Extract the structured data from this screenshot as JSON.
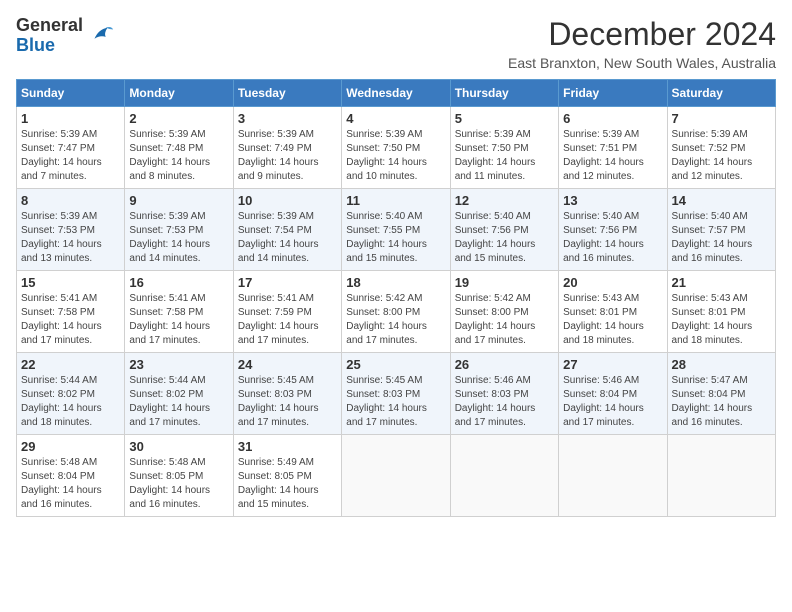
{
  "logo": {
    "line1": "General",
    "line2": "Blue"
  },
  "title": "December 2024",
  "location": "East Branxton, New South Wales, Australia",
  "days_header": [
    "Sunday",
    "Monday",
    "Tuesday",
    "Wednesday",
    "Thursday",
    "Friday",
    "Saturday"
  ],
  "weeks": [
    [
      {
        "day": "1",
        "sunrise": "5:39 AM",
        "sunset": "7:47 PM",
        "daylight": "14 hours and 7 minutes."
      },
      {
        "day": "2",
        "sunrise": "5:39 AM",
        "sunset": "7:48 PM",
        "daylight": "14 hours and 8 minutes."
      },
      {
        "day": "3",
        "sunrise": "5:39 AM",
        "sunset": "7:49 PM",
        "daylight": "14 hours and 9 minutes."
      },
      {
        "day": "4",
        "sunrise": "5:39 AM",
        "sunset": "7:50 PM",
        "daylight": "14 hours and 10 minutes."
      },
      {
        "day": "5",
        "sunrise": "5:39 AM",
        "sunset": "7:50 PM",
        "daylight": "14 hours and 11 minutes."
      },
      {
        "day": "6",
        "sunrise": "5:39 AM",
        "sunset": "7:51 PM",
        "daylight": "14 hours and 12 minutes."
      },
      {
        "day": "7",
        "sunrise": "5:39 AM",
        "sunset": "7:52 PM",
        "daylight": "14 hours and 12 minutes."
      }
    ],
    [
      {
        "day": "8",
        "sunrise": "5:39 AM",
        "sunset": "7:53 PM",
        "daylight": "14 hours and 13 minutes."
      },
      {
        "day": "9",
        "sunrise": "5:39 AM",
        "sunset": "7:53 PM",
        "daylight": "14 hours and 14 minutes."
      },
      {
        "day": "10",
        "sunrise": "5:39 AM",
        "sunset": "7:54 PM",
        "daylight": "14 hours and 14 minutes."
      },
      {
        "day": "11",
        "sunrise": "5:40 AM",
        "sunset": "7:55 PM",
        "daylight": "14 hours and 15 minutes."
      },
      {
        "day": "12",
        "sunrise": "5:40 AM",
        "sunset": "7:56 PM",
        "daylight": "14 hours and 15 minutes."
      },
      {
        "day": "13",
        "sunrise": "5:40 AM",
        "sunset": "7:56 PM",
        "daylight": "14 hours and 16 minutes."
      },
      {
        "day": "14",
        "sunrise": "5:40 AM",
        "sunset": "7:57 PM",
        "daylight": "14 hours and 16 minutes."
      }
    ],
    [
      {
        "day": "15",
        "sunrise": "5:41 AM",
        "sunset": "7:58 PM",
        "daylight": "14 hours and 17 minutes."
      },
      {
        "day": "16",
        "sunrise": "5:41 AM",
        "sunset": "7:58 PM",
        "daylight": "14 hours and 17 minutes."
      },
      {
        "day": "17",
        "sunrise": "5:41 AM",
        "sunset": "7:59 PM",
        "daylight": "14 hours and 17 minutes."
      },
      {
        "day": "18",
        "sunrise": "5:42 AM",
        "sunset": "8:00 PM",
        "daylight": "14 hours and 17 minutes."
      },
      {
        "day": "19",
        "sunrise": "5:42 AM",
        "sunset": "8:00 PM",
        "daylight": "14 hours and 17 minutes."
      },
      {
        "day": "20",
        "sunrise": "5:43 AM",
        "sunset": "8:01 PM",
        "daylight": "14 hours and 18 minutes."
      },
      {
        "day": "21",
        "sunrise": "5:43 AM",
        "sunset": "8:01 PM",
        "daylight": "14 hours and 18 minutes."
      }
    ],
    [
      {
        "day": "22",
        "sunrise": "5:44 AM",
        "sunset": "8:02 PM",
        "daylight": "14 hours and 18 minutes."
      },
      {
        "day": "23",
        "sunrise": "5:44 AM",
        "sunset": "8:02 PM",
        "daylight": "14 hours and 17 minutes."
      },
      {
        "day": "24",
        "sunrise": "5:45 AM",
        "sunset": "8:03 PM",
        "daylight": "14 hours and 17 minutes."
      },
      {
        "day": "25",
        "sunrise": "5:45 AM",
        "sunset": "8:03 PM",
        "daylight": "14 hours and 17 minutes."
      },
      {
        "day": "26",
        "sunrise": "5:46 AM",
        "sunset": "8:03 PM",
        "daylight": "14 hours and 17 minutes."
      },
      {
        "day": "27",
        "sunrise": "5:46 AM",
        "sunset": "8:04 PM",
        "daylight": "14 hours and 17 minutes."
      },
      {
        "day": "28",
        "sunrise": "5:47 AM",
        "sunset": "8:04 PM",
        "daylight": "14 hours and 16 minutes."
      }
    ],
    [
      {
        "day": "29",
        "sunrise": "5:48 AM",
        "sunset": "8:04 PM",
        "daylight": "14 hours and 16 minutes."
      },
      {
        "day": "30",
        "sunrise": "5:48 AM",
        "sunset": "8:05 PM",
        "daylight": "14 hours and 16 minutes."
      },
      {
        "day": "31",
        "sunrise": "5:49 AM",
        "sunset": "8:05 PM",
        "daylight": "14 hours and 15 minutes."
      },
      null,
      null,
      null,
      null
    ]
  ],
  "labels": {
    "sunrise": "Sunrise:",
    "sunset": "Sunset:",
    "daylight": "Daylight:"
  }
}
